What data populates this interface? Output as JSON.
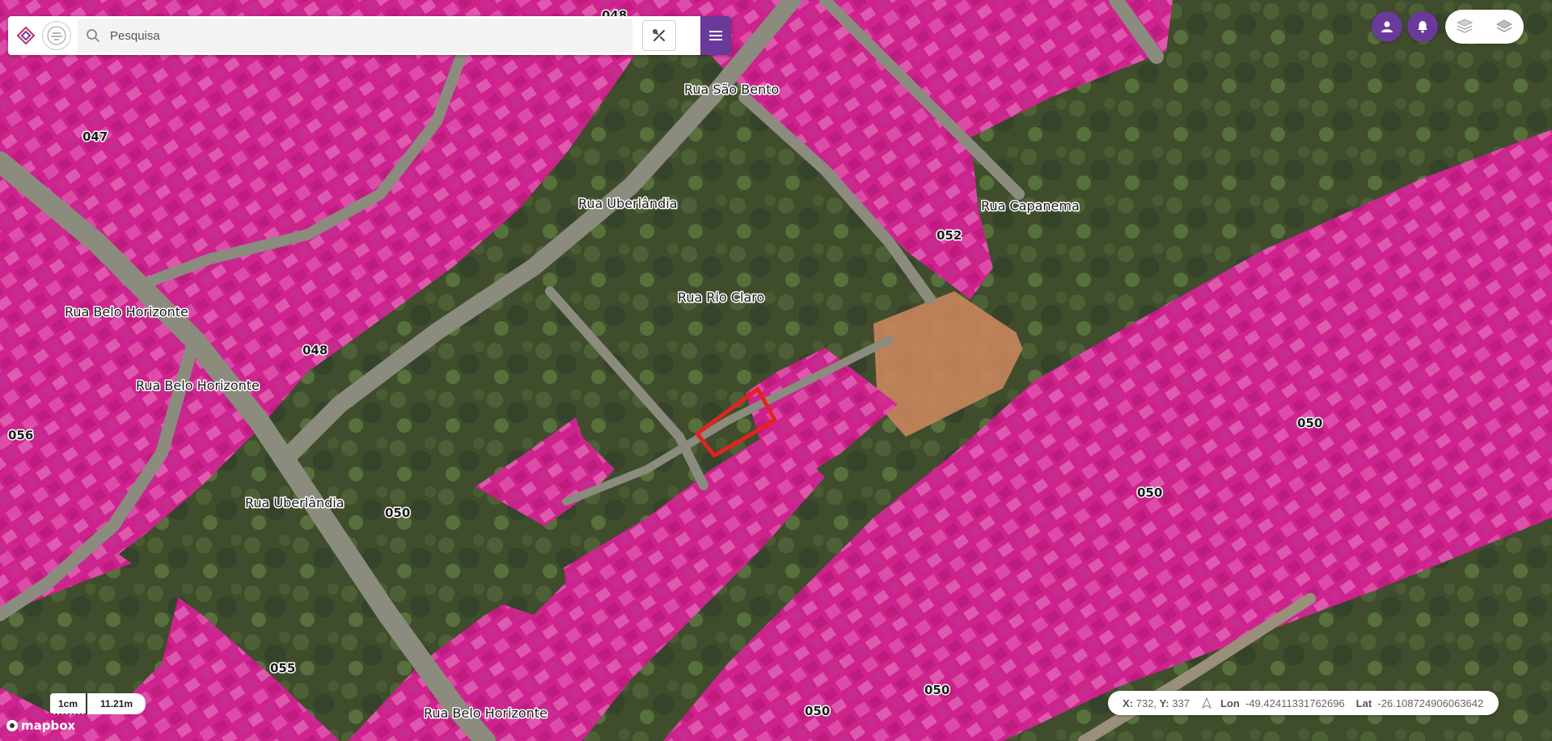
{
  "search": {
    "placeholder": "Pesquisa"
  },
  "map": {
    "street_labels": [
      "Rua São Bento",
      "Rua Uberlândia",
      "Rua Capanema",
      "Rua Rio Claro",
      "Rua Belo Horizonte",
      "Rua Belo Horizonte",
      "Rua Uberlândia",
      "Rua Belo Horizonte"
    ],
    "lot_labels": [
      "048",
      "047",
      "052",
      "048",
      "056",
      "050",
      "050",
      "050",
      "055",
      "050",
      "050"
    ],
    "colors": {
      "parcel_fill": "#e0219b",
      "selected_outline": "#e32222",
      "brand_purple": "#6a3a9a"
    }
  },
  "scale": {
    "unit": "1cm",
    "distance": "11.21m"
  },
  "attribution": "mapbox",
  "coordinates": {
    "x_label": "X:",
    "x_value": "732",
    "y_label": "Y:",
    "y_value": "337",
    "lon_label": "Lon",
    "lon_value": "-49.42411331762696",
    "lat_label": "Lat",
    "lat_value": "-26.108724906063642"
  },
  "icons": [
    "logo-diamond-icon",
    "logo-seal-icon",
    "search-icon",
    "tools-icon",
    "menu-icon",
    "user-icon",
    "bell-icon",
    "layers-3d-icon",
    "layers-icon",
    "navigation-arrow-icon"
  ]
}
